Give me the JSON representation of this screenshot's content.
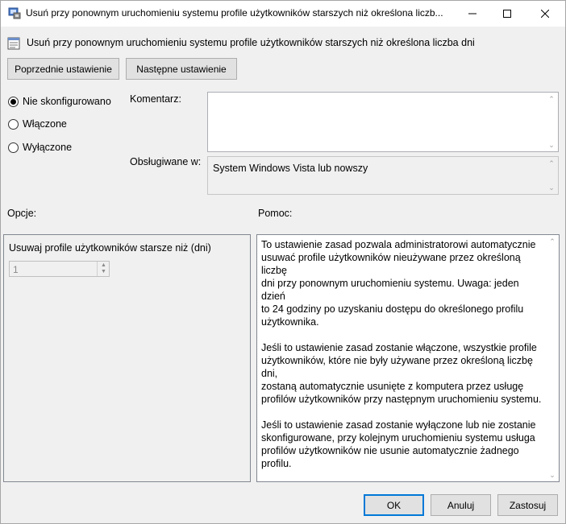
{
  "window": {
    "title": "Usuń przy ponownym uruchomieniu systemu profile użytkowników starszych niż określona liczb...",
    "icon": "policy-settings-icon"
  },
  "header": {
    "title": "Usuń przy ponownym uruchomieniu systemu profile użytkowników starszych niż określona liczba dni",
    "icon": "policy-icon"
  },
  "nav": {
    "prev_label": "Poprzednie ustawienie",
    "next_label": "Następne ustawienie"
  },
  "state": {
    "options": [
      {
        "label": "Nie skonfigurowano",
        "selected": true
      },
      {
        "label": "Włączone",
        "selected": false
      },
      {
        "label": "Wyłączone",
        "selected": false
      }
    ]
  },
  "comment": {
    "label": "Komentarz:",
    "value": ""
  },
  "supported": {
    "label": "Obsługiwane w:",
    "value": "System Windows Vista lub nowszy"
  },
  "options_panel": {
    "heading": "Opcje:",
    "field_label": "Usuwaj profile użytkowników starsze niż (dni)",
    "field_value": "1"
  },
  "help_panel": {
    "heading": "Pomoc:",
    "paragraphs": [
      "To ustawienie zasad pozwala administratorowi automatycznie\nusuwać profile użytkowników nieużywane przez określoną liczbę\ndni przy ponownym uruchomieniu systemu. Uwaga: jeden dzień\nto 24 godziny po uzyskaniu dostępu do określonego profilu\nużytkownika.",
      "Jeśli to ustawienie zasad zostanie włączone, wszystkie profile\nużytkowników, które nie były używane przez określoną liczbę dni,\nzostaną automatycznie usunięte z komputera przez usługę\nprofilów użytkowników przy następnym uruchomieniu systemu.",
      "Jeśli to ustawienie zasad zostanie wyłączone lub nie zostanie\nskonfigurowane, przy kolejnym uruchomieniu systemu usługa\nprofilów użytkowników nie usunie automatycznie żadnego\nprofilu."
    ]
  },
  "footer": {
    "ok_label": "OK",
    "cancel_label": "Anuluj",
    "apply_label": "Zastosuj"
  },
  "colors": {
    "accent": "#0078d7",
    "dialog_bg": "#f0f0f0",
    "button_bg": "#e1e1e1"
  }
}
